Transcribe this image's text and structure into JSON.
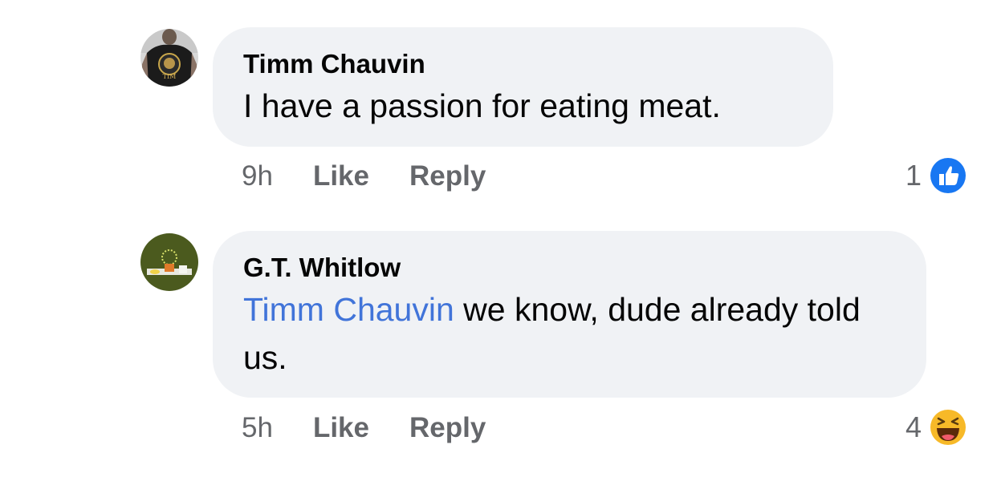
{
  "comments": [
    {
      "author": "Timm Chauvin",
      "avatar_icon": "profile-photo-man-in-black-shirt",
      "avatar_text": "TIM",
      "text": "I have a passion for eating meat.",
      "time": "9h",
      "like_label": "Like",
      "reply_label": "Reply",
      "reaction_count": "1",
      "reaction_icon": "like-thumb-icon",
      "reaction_color": "#1877f2"
    },
    {
      "author": "G.T. Whitlow",
      "avatar_icon": "profile-photo-olive-green",
      "mention": "Timm Chauvin",
      "text_after_mention": " we know, dude already told us.",
      "time": "5h",
      "like_label": "Like",
      "reply_label": "Reply",
      "reaction_count": "4",
      "reaction_icon": "haha-laugh-icon",
      "reaction_color": "#f7b928"
    }
  ],
  "colors": {
    "bubble_bg": "#f0f2f5",
    "mention": "#4174d9",
    "meta_text": "#65676b",
    "avatar_green": "#4b5a1e"
  }
}
